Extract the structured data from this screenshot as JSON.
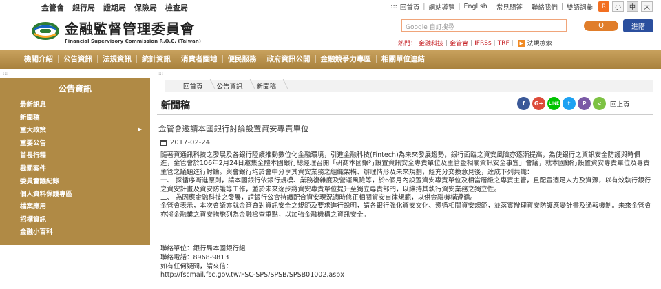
{
  "top_links": [
    "金管會",
    "銀行局",
    "證期局",
    "保險局",
    "檢查局"
  ],
  "utility_links": [
    "回首頁",
    "網站導覽",
    "English",
    "常見問答",
    "聯絡我們",
    "雙語詞彙"
  ],
  "utility_prefix": ":::",
  "font_sizes": [
    "小",
    "中",
    "大"
  ],
  "rss_label": "R",
  "logo": {
    "name_cn": "金融監督管理委員會",
    "name_en": "Financial Supervisory Commission R.O.C. (Taiwan)"
  },
  "search": {
    "placeholder": "Google 自訂搜尋",
    "button_label": "Q",
    "advanced_label": "進階"
  },
  "hot_keywords": {
    "label": "熱門：",
    "items": [
      "金融科技",
      "金管會",
      "IFRSs",
      "TRF"
    ],
    "extra": "法規檢索"
  },
  "nav": [
    "機關介紹",
    "公告資訊",
    "法規資訊",
    "統計資訊",
    "消費者園地",
    "便民服務",
    "政府資訊公開",
    "金融競爭力專區",
    "相關單位連結"
  ],
  "sidebar": {
    "title": "公告資訊",
    "items": [
      "最新訊息",
      "新聞稿",
      "重大政策",
      "重要公告",
      "首長行程",
      "裁罰案件",
      "委員會議紀錄",
      "個人資料保護專區",
      "檔案應用",
      "招標資訊",
      "金融小百科"
    ]
  },
  "breadcrumb": [
    "回首頁",
    "公告資訊",
    "新聞稿"
  ],
  "page_title": "新聞稿",
  "share": {
    "icons": [
      "f",
      "G+",
      "LINE",
      "t",
      "P",
      "<"
    ],
    "colors": [
      "#3b5998",
      "#dd4b39",
      "#00c300",
      "#1da1f2",
      "#7b5aa6",
      "#7dc243"
    ],
    "back_label": "回上頁"
  },
  "article": {
    "title": "金管會邀請本國銀行討論設置資安專責單位",
    "date": "2017-02-24",
    "paragraphs": [
      "隨著資通訊科技之發展及各銀行陸續推動數位化金融環境，引進金融科技(Fintech)為未來發展趨勢，銀行面臨之資安風險亦逐漸提高，為使銀行之資訊安全防護與時俱進，金管會於106年2月24日邀集全體本國銀行總經理召開「研商本國銀行設置資訊安全專責單位及主管暨相關資訊安全事宜」會議，就本國銀行設置資安專責單位及專責主管之議題進行討論。與會銀行均於會中分享其資安業務之組織架構、辦理情形及未來規劃，經充分交換意見後，達成下列共識：",
      "一、 採循序漸進原則，請本國銀行依銀行規模、業務複雜度及營運風險等，於6個月內設置資安專責單位及相當層級之專責主管，且配置適足人力及資源，以有效執行銀行之資安計畫及資安防護等工作，並於未來逐步將資安專責單位提升至獨立專責部門，以維持其執行資安業務之獨立性。",
      "二、 為因應金融科技之發展，請銀行公會持續配合資安現況適時修正相關資安自律規範，以供金融機構遵循。",
      "金管會表示，本次會議亦就金管會對資訊安全之規範及要求進行說明，請各銀行強化資安文化、遵循相關資安規範，並落實辦理資安防護應變計畫及通報機制。未來金管會亦將金融業之資安措施列為金融檢查重點，以加強金融機構之資訊安全。"
    ]
  },
  "contact": {
    "unit": "聯絡單位：銀行局本國銀行組",
    "phone": "聯絡電話：8968-9813",
    "question": "如有任何疑問，請來信：",
    "url": "http://fscmail.fsc.gov.tw/FSC-SPS/SPSB/SPSB01002.aspx"
  },
  "decor": {
    "dots": ":::"
  }
}
